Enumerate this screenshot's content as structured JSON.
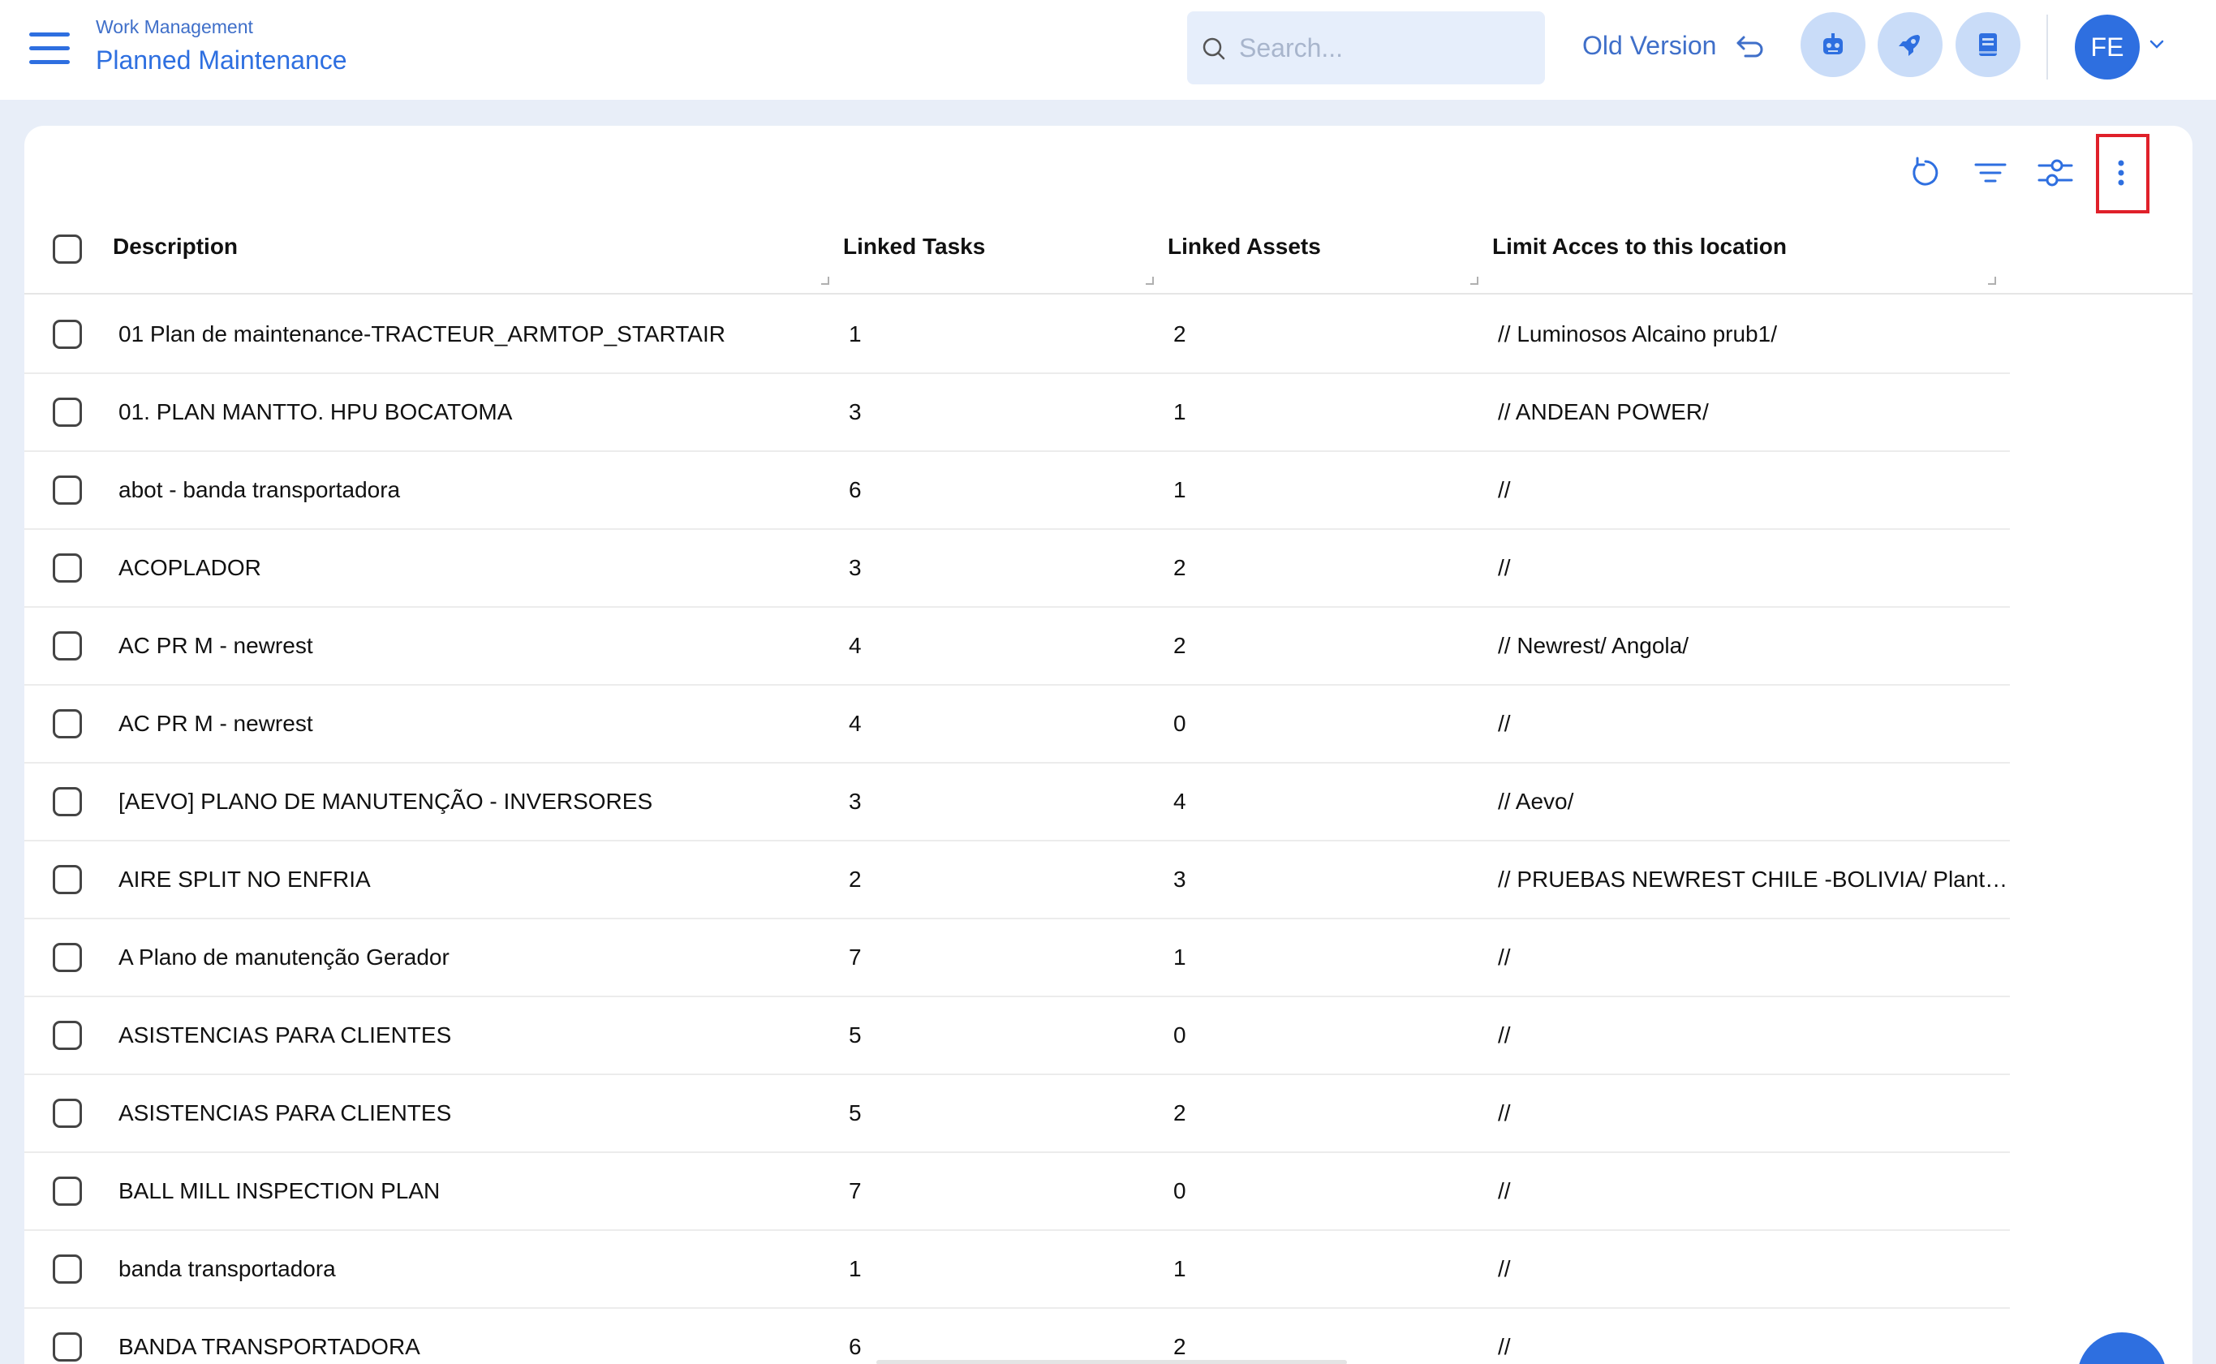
{
  "header": {
    "breadcrumb": "Work Management",
    "title": "Planned Maintenance",
    "search_placeholder": "Search...",
    "old_version_label": "Old Version",
    "avatar_initials": "FE"
  },
  "colors": {
    "accent": "#2e6fe0",
    "page_bg": "#e8eef8",
    "highlight_border": "#e0202a"
  },
  "toolbar": {
    "icons": [
      "refresh-icon",
      "filter-icon",
      "column-settings-icon",
      "more-vertical-icon"
    ]
  },
  "table": {
    "columns": [
      "Description",
      "Linked Tasks",
      "Linked Assets",
      "Limit Acces to this location"
    ],
    "rows": [
      {
        "description": "01 Plan de maintenance-TRACTEUR_ARMTOP_STARTAIR",
        "tasks": "1",
        "assets": "2",
        "location": "// Luminosos Alcaino prub1/"
      },
      {
        "description": "01. PLAN MANTTO. HPU BOCATOMA",
        "tasks": "3",
        "assets": "1",
        "location": "// ANDEAN POWER/"
      },
      {
        "description": "abot - banda transportadora",
        "tasks": "6",
        "assets": "1",
        "location": "//"
      },
      {
        "description": "ACOPLADOR",
        "tasks": "3",
        "assets": "2",
        "location": "//"
      },
      {
        "description": "AC PR M - newrest",
        "tasks": "4",
        "assets": "2",
        "location": "// Newrest/ Angola/"
      },
      {
        "description": "AC PR M - newrest",
        "tasks": "4",
        "assets": "0",
        "location": "//"
      },
      {
        "description": "[AEVO] PLANO DE MANUTENÇÃO - INVERSORES",
        "tasks": "3",
        "assets": "4",
        "location": "// Aevo/"
      },
      {
        "description": "AIRE SPLIT NO ENFRIA",
        "tasks": "2",
        "assets": "3",
        "location": "// PRUEBAS NEWREST CHILE -BOLIVIA/ Planta..."
      },
      {
        "description": "A Plano de manutenção Gerador",
        "tasks": "7",
        "assets": "1",
        "location": "//"
      },
      {
        "description": "ASISTENCIAS PARA CLIENTES",
        "tasks": "5",
        "assets": "0",
        "location": "//"
      },
      {
        "description": "ASISTENCIAS PARA CLIENTES",
        "tasks": "5",
        "assets": "2",
        "location": "//"
      },
      {
        "description": "BALL MILL INSPECTION PLAN",
        "tasks": "7",
        "assets": "0",
        "location": "//"
      },
      {
        "description": "banda transportadora",
        "tasks": "1",
        "assets": "1",
        "location": "//"
      },
      {
        "description": "BANDA TRANSPORTADORA",
        "tasks": "6",
        "assets": "2",
        "location": "//"
      }
    ]
  }
}
